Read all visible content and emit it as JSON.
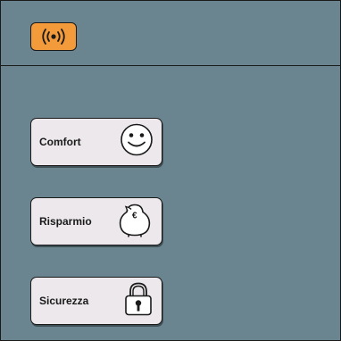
{
  "header": {
    "alarm_icon": "broadcast-alarm-icon",
    "alarm_color": "#f39a3a"
  },
  "colors": {
    "panel_background": "#6b8590",
    "card_background": "#ece8eb",
    "border": "#1a1a1a"
  },
  "modes": [
    {
      "label": "Comfort",
      "icon": "smiley-face-icon"
    },
    {
      "label": "Risparmio",
      "icon": "piggy-bank-euro-icon"
    },
    {
      "label": "Sicurezza",
      "icon": "padlock-icon"
    }
  ]
}
